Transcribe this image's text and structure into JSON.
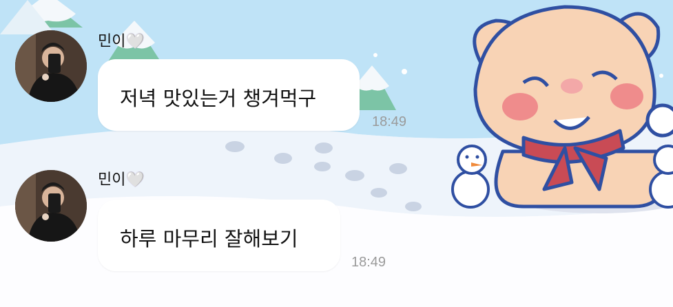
{
  "colors": {
    "bubble": "#ffffff",
    "sky": "#bfe3f7",
    "snow": "#eef4fb",
    "time": "#9a9a9a"
  },
  "messages": [
    {
      "sender": "민이",
      "sender_icon": "white-heart-emoji",
      "heart": "🤍",
      "text": "저녁 맛있는거 챙겨먹구",
      "time": "18:49"
    },
    {
      "sender": "민이",
      "sender_icon": "white-heart-emoji",
      "heart": "🤍",
      "text": "하루 마무리 잘해보기",
      "time": "18:49"
    }
  ],
  "wallpaper": {
    "character": "pig-with-red-scarf",
    "decor": [
      "snowman",
      "snowy-tree",
      "footprints"
    ]
  }
}
